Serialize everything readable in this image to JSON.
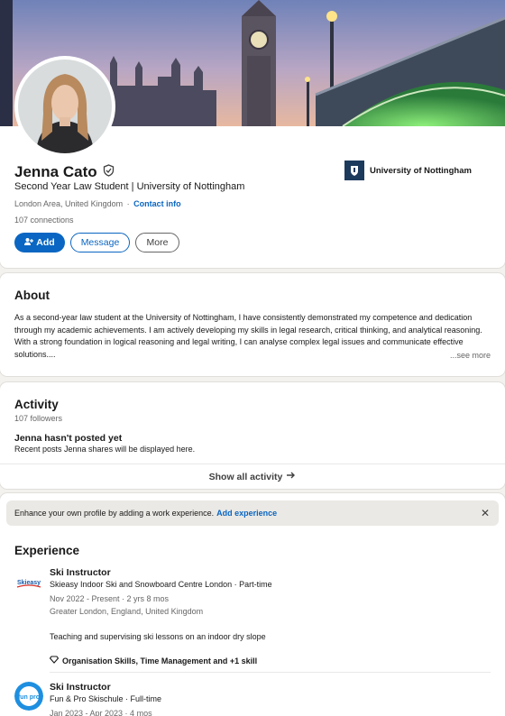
{
  "profile": {
    "name": "Jenna Cato",
    "headline": "Second Year Law Student | University of Nottingham",
    "location": "London Area, United Kingdom",
    "location_separator": "·",
    "contact_info": "Contact info",
    "connections": "107 connections",
    "buttons": {
      "add": "Add",
      "message": "Message",
      "more": "More"
    },
    "school": "University of Nottingham"
  },
  "about": {
    "title": "About",
    "text": "As a second-year law student at the University of Nottingham, I have consistently demonstrated my competence and dedication through my academic achievements. I am actively developing my skills in legal research, critical thinking, and analytical reasoning. With a strong foundation in logical reasoning and legal writing, I can analyse complex legal issues and communicate effective solutions....",
    "see_more": "...see more"
  },
  "activity": {
    "title": "Activity",
    "followers": "107 followers",
    "empty_title": "Jenna hasn't posted yet",
    "empty_text": "Recent posts Jenna shares will be displayed here.",
    "show_all": "Show all activity"
  },
  "experience": {
    "notice_text": "Enhance your own profile by adding a work experience.",
    "notice_link": "Add experience",
    "title": "Experience",
    "items": [
      {
        "title": "Ski Instructor",
        "company": "Skieasy Indoor Ski and Snowboard Centre London · Part-time",
        "dates": "Nov 2022 - Present · 2 yrs 8 mos",
        "location": "Greater London, England, United Kingdom",
        "description": "Teaching and supervising ski lessons on an indoor dry slope",
        "skills": "Organisation Skills, Time Management and +1 skill",
        "logo_text": "Skieasy"
      },
      {
        "title": "Ski Instructor",
        "company": "Fun & Pro Skischule · Full-time",
        "dates": "Jan 2023 - Apr 2023 · 4 mos",
        "logo_text": "fun pro"
      }
    ]
  },
  "colors": {
    "accent": "#0a66c2",
    "background": "#f4f2ee"
  }
}
